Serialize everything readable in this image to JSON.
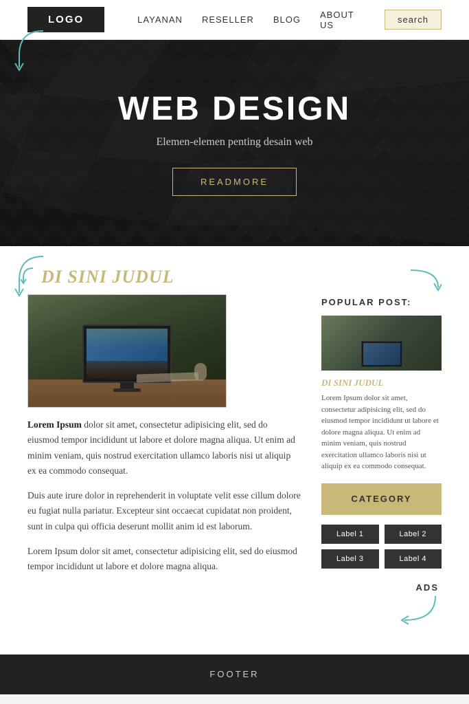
{
  "navbar": {
    "logo": "LOGO",
    "links": [
      {
        "label": "LAYANAN",
        "id": "layanan"
      },
      {
        "label": "RESELLER",
        "id": "reseller"
      },
      {
        "label": "BLOG",
        "id": "blog"
      },
      {
        "label": "ABOUT US",
        "id": "about"
      },
      {
        "label": "search",
        "id": "search"
      }
    ]
  },
  "hero": {
    "title": "WEB DESIGN",
    "subtitle": "Elemen-elemen penting desain web",
    "cta": "READMORE"
  },
  "section": {
    "title": "DI SINI JUDUL",
    "body1_bold": "Lorem Ipsum",
    "body1": " dolor sit amet, consectetur adipisicing elit, sed do eiusmod tempor incididunt ut labore et dolore magna aliqua. Ut enim ad minim veniam, quis nostrud exercitation ullamco laboris nisi ut aliquip ex ea commodo consequat.",
    "body2": "Duis aute irure dolor in reprehenderit in voluptate velit esse cillum dolore eu fugiat nulla pariatur. Excepteur sint occaecat cupidatat non proident, sunt in culpa qui officia deserunt mollit anim id est laborum.",
    "body3": "Lorem Ipsum dolor sit amet, consectetur adipisicing elit, sed do eiusmod tempor incididunt ut labore et dolore magna aliqua."
  },
  "sidebar": {
    "popular_title": "POPULAR POST:",
    "popular_post_title": "DI SINI JUDUL",
    "popular_post_text": "Lorem Ipsum dolor sit amet, consectetur adipisicing elit, sed do eiusmod tempor incididunt ut labore et dolore magna aliqua. Ut enim ad minim veniam, quis nostrud exercitation ullamco laboris nisi ut aliquip ex ea commodo consequat.",
    "category_label": "CATEGORY",
    "tags": [
      "Label 1",
      "Label 2",
      "Label 3",
      "Label 4"
    ],
    "ads_label": "ADS"
  },
  "footer": {
    "label": "FOOTER"
  },
  "colors": {
    "accent_gold": "#c8b87a",
    "accent_teal": "#5dbcb8",
    "dark_bg": "#222",
    "tag_bg": "#333"
  }
}
